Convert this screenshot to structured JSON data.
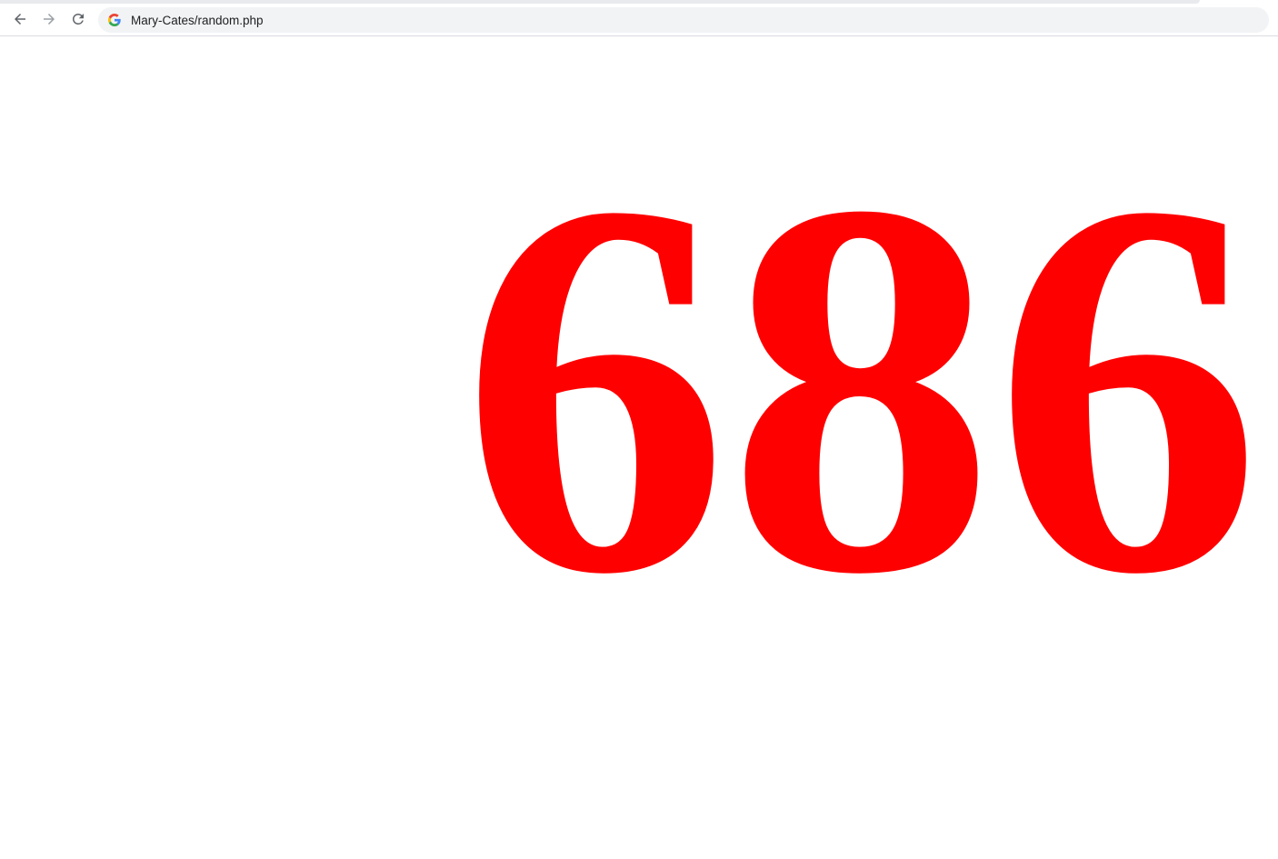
{
  "browser": {
    "address_bar": {
      "url": "Mary-Cates/random.php"
    }
  },
  "page": {
    "random_number": "686",
    "number_color": "#ff0000"
  },
  "icons": {
    "back": "arrow-left-icon",
    "forward": "arrow-right-icon",
    "reload": "reload-icon",
    "site": "google-g-icon"
  }
}
